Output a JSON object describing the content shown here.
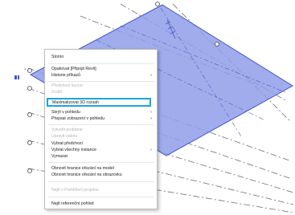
{
  "colors": {
    "plane_fill": "#8f9ee9",
    "plane_edge": "#3f56c9",
    "highlight_border": "#1aa6dc"
  },
  "icons": [
    "grid-bubble-icon",
    "level-marker-icon"
  ],
  "viewport": {
    "level_tag": "1"
  },
  "context_menu": {
    "items": [
      {
        "label": "Storno",
        "disabled": false,
        "submenu": false
      },
      {
        "label": "Opakovat [Připojit Revit]",
        "disabled": false,
        "submenu": false
      },
      {
        "label": "Historie příkazů",
        "disabled": false,
        "submenu": true
      },
      {
        "label": "Předchozí kurzor",
        "disabled": true,
        "submenu": false
      },
      {
        "label": "Zrušit",
        "disabled": true,
        "submenu": false
      },
      {
        "label": "Maximalizovat 3D rozsah",
        "disabled": false,
        "submenu": false,
        "highlighted": true
      },
      {
        "label": "Skrýt v pohledu",
        "disabled": false,
        "submenu": true
      },
      {
        "label": "Přepsat zobrazení v pohledu",
        "disabled": false,
        "submenu": true
      },
      {
        "label": "Vytvořit podobné",
        "disabled": true,
        "submenu": false
      },
      {
        "label": "Upravit rodinu",
        "disabled": true,
        "submenu": false
      },
      {
        "label": "Vybrat předchozí",
        "disabled": false,
        "submenu": false
      },
      {
        "label": "Vybrat všechny instance",
        "disabled": false,
        "submenu": true
      },
      {
        "label": "Vymazat",
        "disabled": false,
        "submenu": false
      },
      {
        "label": "Obnovit hranice ořezání na model",
        "disabled": false,
        "submenu": false
      },
      {
        "label": "Obnovit hranice ořezání na obrazovku",
        "disabled": false,
        "submenu": false
      },
      {
        "label": "Najít v Prohlížeči projektu",
        "disabled": true,
        "submenu": false
      },
      {
        "label": "Najít referenční pohled",
        "disabled": false,
        "submenu": false
      }
    ]
  }
}
